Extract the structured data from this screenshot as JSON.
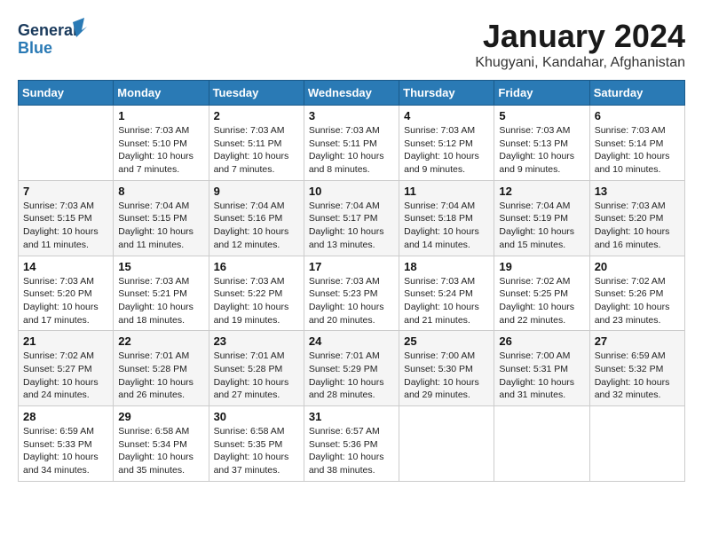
{
  "header": {
    "logo_general": "General",
    "logo_blue": "Blue",
    "title": "January 2024",
    "subtitle": "Khugyani, Kandahar, Afghanistan"
  },
  "days_of_week": [
    "Sunday",
    "Monday",
    "Tuesday",
    "Wednesday",
    "Thursday",
    "Friday",
    "Saturday"
  ],
  "weeks": [
    [
      {
        "day": "",
        "info": ""
      },
      {
        "day": "1",
        "info": "Sunrise: 7:03 AM\nSunset: 5:10 PM\nDaylight: 10 hours\nand 7 minutes."
      },
      {
        "day": "2",
        "info": "Sunrise: 7:03 AM\nSunset: 5:11 PM\nDaylight: 10 hours\nand 7 minutes."
      },
      {
        "day": "3",
        "info": "Sunrise: 7:03 AM\nSunset: 5:11 PM\nDaylight: 10 hours\nand 8 minutes."
      },
      {
        "day": "4",
        "info": "Sunrise: 7:03 AM\nSunset: 5:12 PM\nDaylight: 10 hours\nand 9 minutes."
      },
      {
        "day": "5",
        "info": "Sunrise: 7:03 AM\nSunset: 5:13 PM\nDaylight: 10 hours\nand 9 minutes."
      },
      {
        "day": "6",
        "info": "Sunrise: 7:03 AM\nSunset: 5:14 PM\nDaylight: 10 hours\nand 10 minutes."
      }
    ],
    [
      {
        "day": "7",
        "info": "Sunrise: 7:03 AM\nSunset: 5:15 PM\nDaylight: 10 hours\nand 11 minutes."
      },
      {
        "day": "8",
        "info": "Sunrise: 7:04 AM\nSunset: 5:15 PM\nDaylight: 10 hours\nand 11 minutes."
      },
      {
        "day": "9",
        "info": "Sunrise: 7:04 AM\nSunset: 5:16 PM\nDaylight: 10 hours\nand 12 minutes."
      },
      {
        "day": "10",
        "info": "Sunrise: 7:04 AM\nSunset: 5:17 PM\nDaylight: 10 hours\nand 13 minutes."
      },
      {
        "day": "11",
        "info": "Sunrise: 7:04 AM\nSunset: 5:18 PM\nDaylight: 10 hours\nand 14 minutes."
      },
      {
        "day": "12",
        "info": "Sunrise: 7:04 AM\nSunset: 5:19 PM\nDaylight: 10 hours\nand 15 minutes."
      },
      {
        "day": "13",
        "info": "Sunrise: 7:03 AM\nSunset: 5:20 PM\nDaylight: 10 hours\nand 16 minutes."
      }
    ],
    [
      {
        "day": "14",
        "info": "Sunrise: 7:03 AM\nSunset: 5:20 PM\nDaylight: 10 hours\nand 17 minutes."
      },
      {
        "day": "15",
        "info": "Sunrise: 7:03 AM\nSunset: 5:21 PM\nDaylight: 10 hours\nand 18 minutes."
      },
      {
        "day": "16",
        "info": "Sunrise: 7:03 AM\nSunset: 5:22 PM\nDaylight: 10 hours\nand 19 minutes."
      },
      {
        "day": "17",
        "info": "Sunrise: 7:03 AM\nSunset: 5:23 PM\nDaylight: 10 hours\nand 20 minutes."
      },
      {
        "day": "18",
        "info": "Sunrise: 7:03 AM\nSunset: 5:24 PM\nDaylight: 10 hours\nand 21 minutes."
      },
      {
        "day": "19",
        "info": "Sunrise: 7:02 AM\nSunset: 5:25 PM\nDaylight: 10 hours\nand 22 minutes."
      },
      {
        "day": "20",
        "info": "Sunrise: 7:02 AM\nSunset: 5:26 PM\nDaylight: 10 hours\nand 23 minutes."
      }
    ],
    [
      {
        "day": "21",
        "info": "Sunrise: 7:02 AM\nSunset: 5:27 PM\nDaylight: 10 hours\nand 24 minutes."
      },
      {
        "day": "22",
        "info": "Sunrise: 7:01 AM\nSunset: 5:28 PM\nDaylight: 10 hours\nand 26 minutes."
      },
      {
        "day": "23",
        "info": "Sunrise: 7:01 AM\nSunset: 5:28 PM\nDaylight: 10 hours\nand 27 minutes."
      },
      {
        "day": "24",
        "info": "Sunrise: 7:01 AM\nSunset: 5:29 PM\nDaylight: 10 hours\nand 28 minutes."
      },
      {
        "day": "25",
        "info": "Sunrise: 7:00 AM\nSunset: 5:30 PM\nDaylight: 10 hours\nand 29 minutes."
      },
      {
        "day": "26",
        "info": "Sunrise: 7:00 AM\nSunset: 5:31 PM\nDaylight: 10 hours\nand 31 minutes."
      },
      {
        "day": "27",
        "info": "Sunrise: 6:59 AM\nSunset: 5:32 PM\nDaylight: 10 hours\nand 32 minutes."
      }
    ],
    [
      {
        "day": "28",
        "info": "Sunrise: 6:59 AM\nSunset: 5:33 PM\nDaylight: 10 hours\nand 34 minutes."
      },
      {
        "day": "29",
        "info": "Sunrise: 6:58 AM\nSunset: 5:34 PM\nDaylight: 10 hours\nand 35 minutes."
      },
      {
        "day": "30",
        "info": "Sunrise: 6:58 AM\nSunset: 5:35 PM\nDaylight: 10 hours\nand 37 minutes."
      },
      {
        "day": "31",
        "info": "Sunrise: 6:57 AM\nSunset: 5:36 PM\nDaylight: 10 hours\nand 38 minutes."
      },
      {
        "day": "",
        "info": ""
      },
      {
        "day": "",
        "info": ""
      },
      {
        "day": "",
        "info": ""
      }
    ]
  ]
}
